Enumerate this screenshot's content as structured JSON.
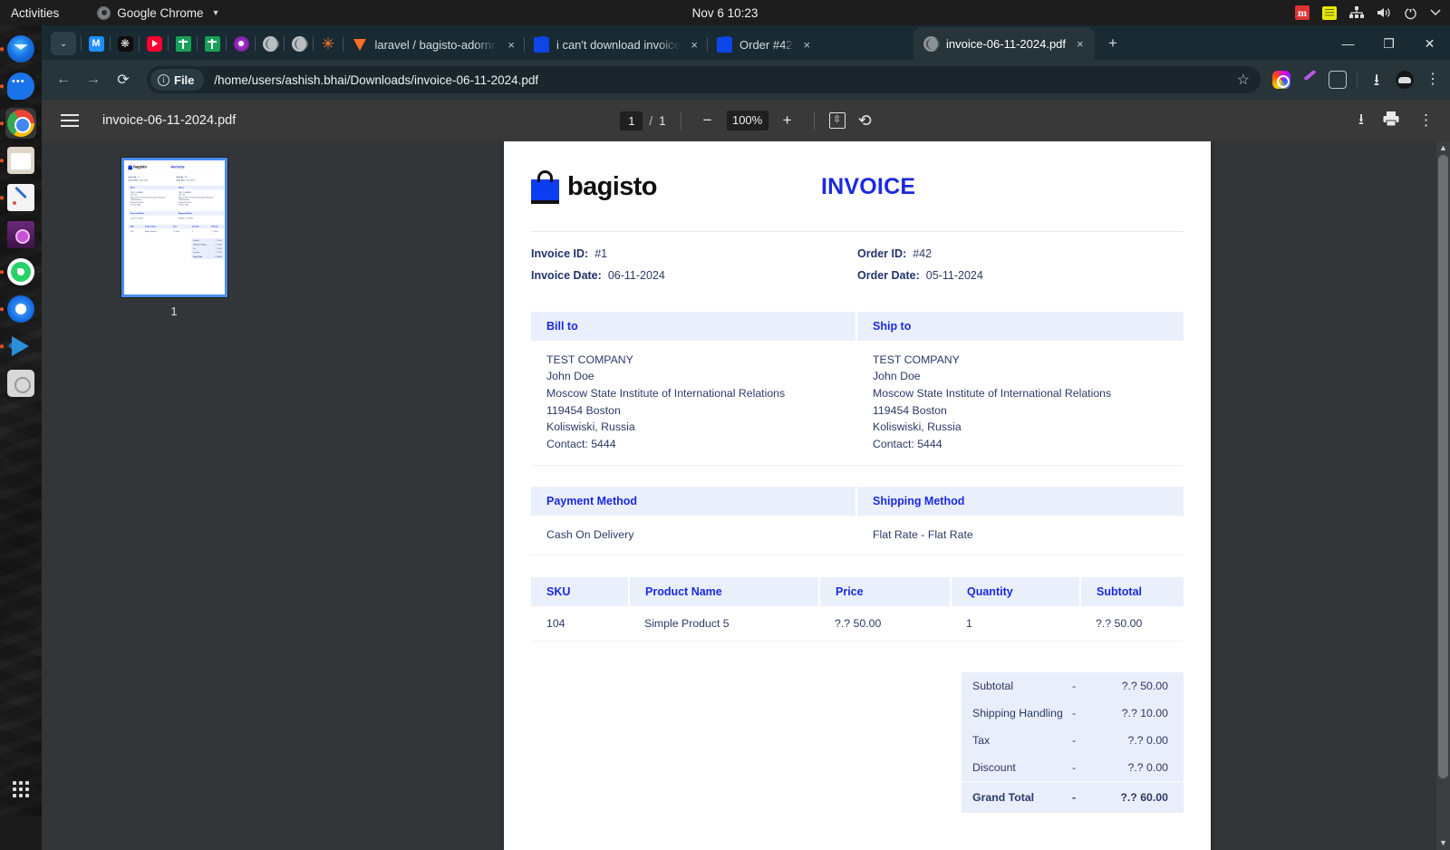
{
  "os_bar": {
    "activities": "Activities",
    "app_name": "Google Chrome",
    "clock": "Nov 6  10:23",
    "tray": {
      "red_badge": "m",
      "list_icon": "list-icon",
      "network_icon": "network-icon",
      "volume_icon": "volume-icon",
      "power_icon": "power-icon",
      "caret_icon": "chevron-down-icon"
    }
  },
  "dock": {
    "items": [
      {
        "name": "thunderbird",
        "label": "Thunderbird Mail",
        "running": true
      },
      {
        "name": "chat",
        "label": "Chat",
        "running": true
      },
      {
        "name": "chrome",
        "label": "Google Chrome",
        "running": true,
        "active": true
      },
      {
        "name": "files",
        "label": "Files",
        "running": true
      },
      {
        "name": "text-editor",
        "label": "Text Editor",
        "running": true
      },
      {
        "name": "video-player",
        "label": "Video Player",
        "running": false
      },
      {
        "name": "whatsapp",
        "label": "WhatsApp",
        "running": true
      },
      {
        "name": "chromium",
        "label": "Chromium",
        "running": true
      },
      {
        "name": "vscode",
        "label": "Visual Studio Code",
        "running": true
      },
      {
        "name": "disks",
        "label": "Disks",
        "running": false
      }
    ],
    "show_apps_label": "Show Applications"
  },
  "browser": {
    "pinned_tabs": [
      {
        "name": "grafana",
        "favicon": "grafana-icon"
      },
      {
        "name": "openai",
        "favicon": "openai-icon"
      },
      {
        "name": "youtube",
        "favicon": "youtube-icon"
      },
      {
        "name": "sheets-1",
        "favicon": "sheets-icon"
      },
      {
        "name": "sheets-2",
        "favicon": "sheets-icon"
      },
      {
        "name": "purple-app",
        "favicon": "purple-circle-icon"
      },
      {
        "name": "globe-1",
        "favicon": "globe-icon"
      },
      {
        "name": "globe-2",
        "favicon": "globe-icon"
      },
      {
        "name": "spark",
        "favicon": "spark-icon"
      }
    ],
    "tabs": [
      {
        "title": "laravel / bagisto-adornm",
        "favicon": "gitlab-icon",
        "active": false
      },
      {
        "title": "i can't download invoice",
        "favicon": "bagisto-icon",
        "active": false
      },
      {
        "title": "Order #42",
        "favicon": "bagisto-icon",
        "active": false
      },
      {
        "title": "invoice-06-11-2024.pdf",
        "favicon": "pdf-globe-icon",
        "active": true
      }
    ],
    "tab_close_label": "×",
    "new_tab_label": "+",
    "tab_search_label": "⌄",
    "window_controls": {
      "minimize": "—",
      "maximize": "❐",
      "close": "✕"
    },
    "nav": {
      "back": "←",
      "forward": "→",
      "reload": "⟳"
    },
    "omnibox": {
      "scheme_chip": "File",
      "url": "/home/users/ashish.bhai/Downloads/invoice-06-11-2024.pdf",
      "bookmark_label": "☆"
    },
    "extensions": [
      {
        "name": "instagram-extension-icon"
      },
      {
        "name": "feather-extension-icon"
      },
      {
        "name": "puzzle-extensions-icon"
      },
      {
        "name": "downloads-icon"
      },
      {
        "name": "profile-avatar"
      },
      {
        "name": "chrome-menu-icon"
      }
    ]
  },
  "pdf_viewer": {
    "sidebar_toggle_label": "Sidebar",
    "file_name": "invoice-06-11-2024.pdf",
    "current_page": "1",
    "page_separator": "/",
    "total_pages": "1",
    "zoom_out_label": "−",
    "zoom_level": "100%",
    "zoom_in_label": "+",
    "fit_label": "Fit to page",
    "rotate_label": "Rotate",
    "download_label": "Download",
    "print_label": "Print",
    "more_label": "More actions",
    "thumbnail_page_label": "1"
  },
  "invoice": {
    "brand": "bagisto",
    "title": "INVOICE",
    "meta_left": [
      {
        "label": "Invoice ID:",
        "value": "#1"
      },
      {
        "label": "Invoice Date:",
        "value": "06-11-2024"
      }
    ],
    "meta_right": [
      {
        "label": "Order ID:",
        "value": "#42"
      },
      {
        "label": "Order Date:",
        "value": "05-11-2024"
      }
    ],
    "bill_to": {
      "heading": "Bill to",
      "lines": [
        "TEST COMPANY",
        "John Doe",
        "Moscow State Institute of International Relations",
        "119454 Boston",
        "Koliswiski, Russia",
        "Contact: 5444"
      ]
    },
    "ship_to": {
      "heading": "Ship to",
      "lines": [
        "TEST COMPANY",
        "John Doe",
        "Moscow State Institute of International Relations",
        "119454 Boston",
        "Koliswiski, Russia",
        "Contact: 5444"
      ]
    },
    "payment_method": {
      "heading": "Payment Method",
      "value": "Cash On Delivery"
    },
    "shipping_method": {
      "heading": "Shipping Method",
      "value": "Flat Rate - Flat Rate"
    },
    "items_table": {
      "columns": [
        "SKU",
        "Product Name",
        "Price",
        "Quantity",
        "Subtotal"
      ],
      "rows": [
        {
          "sku": "104",
          "name": "Simple Product 5",
          "price": "?.? 50.00",
          "qty": "1",
          "subtotal": "?.? 50.00"
        }
      ]
    },
    "totals": [
      {
        "label": "Subtotal",
        "dash": "-",
        "value": "?.? 50.00",
        "grand": false
      },
      {
        "label": "Shipping Handling",
        "dash": "-",
        "value": "?.? 10.00",
        "grand": false
      },
      {
        "label": "Tax",
        "dash": "-",
        "value": "?.? 0.00",
        "grand": false
      },
      {
        "label": "Discount",
        "dash": "-",
        "value": "?.? 0.00",
        "grand": false
      },
      {
        "label": "Grand Total",
        "dash": "-",
        "value": "?.? 60.00",
        "grand": true
      }
    ]
  },
  "colors": {
    "accent_blue": "#1a2ae0",
    "header_bg": "#eaf0fb",
    "totals_bg": "#e9eefb",
    "text_navy": "#2b3a67",
    "chrome_frame": "#192a32",
    "chrome_toolbar": "#27353b",
    "pdf_toolbar": "#393939",
    "viewer_bg": "#323639"
  }
}
